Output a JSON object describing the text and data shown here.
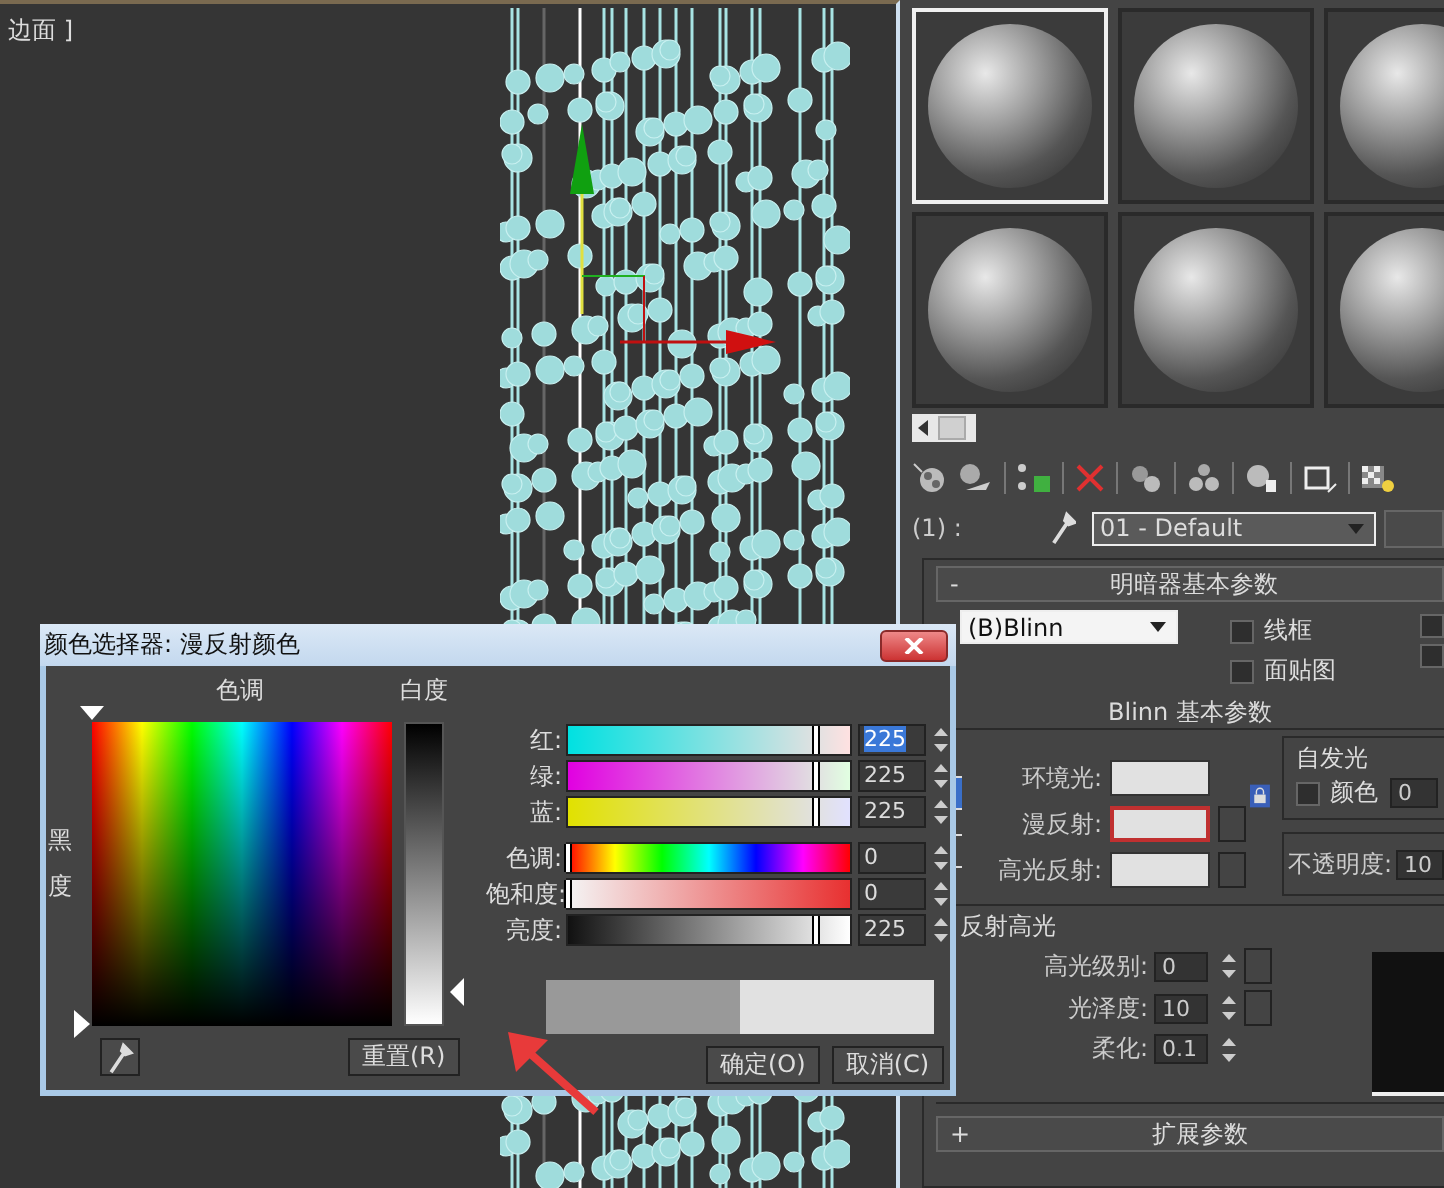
{
  "viewport": {
    "label": "边面 ]"
  },
  "material_editor": {
    "slots": [
      {
        "selected": true
      },
      {
        "selected": false
      },
      {
        "selected": false
      },
      {
        "selected": false
      },
      {
        "selected": false
      },
      {
        "selected": false
      }
    ],
    "material_row": {
      "index": "(1) :",
      "name": "01 - Default"
    },
    "shader_rollout": {
      "sign": "-",
      "title": "明暗器基本参数",
      "shader": "(B)Blinn",
      "checkboxes": [
        {
          "label": "线框",
          "checked": false
        },
        {
          "label": "面贴图",
          "checked": false
        }
      ],
      "extra_checkboxes": [
        {
          "checked": false
        },
        {
          "checked": false
        }
      ]
    },
    "blinn_rollout": {
      "title": "Blinn 基本参数",
      "colors": [
        {
          "label": "环境光:",
          "selected": false,
          "map_button": false
        },
        {
          "label": "漫反射:",
          "selected": true,
          "map_button": true
        },
        {
          "label": "高光反射:",
          "selected": false,
          "map_button": true
        }
      ],
      "self_illum": {
        "title": "自发光",
        "checkbox": {
          "label": "颜色",
          "checked": false
        },
        "value": "0"
      },
      "opacity": {
        "label": "不透明度:",
        "value": "10"
      },
      "specular": {
        "title": "反射高光",
        "fields": [
          {
            "label": "高光级别:",
            "value": "0"
          },
          {
            "label": "光泽度:",
            "value": "10"
          },
          {
            "label": "柔化:",
            "value": "0.1"
          }
        ]
      }
    },
    "collapsed_rollouts": [
      {
        "sign": "+",
        "title": "扩展参数"
      }
    ]
  },
  "color_dialog": {
    "title": "颜色选择器: 漫反射颜色",
    "hue_label": "色调",
    "whiteness_label": "白度",
    "blackness_label": "黑度",
    "sliders": [
      {
        "kind": "red",
        "label": "红:",
        "value": "225",
        "level": 0.88,
        "focused": true
      },
      {
        "kind": "green",
        "label": "绿:",
        "value": "225",
        "level": 0.88,
        "focused": false
      },
      {
        "kind": "blue",
        "label": "蓝:",
        "value": "225",
        "level": 0.88,
        "focused": false
      },
      {
        "kind": "hue",
        "label": "色调:",
        "value": "0",
        "level": 0,
        "focused": false
      },
      {
        "kind": "saturation",
        "label": "饱和度:",
        "value": "0",
        "level": 0,
        "focused": false
      },
      {
        "kind": "value",
        "label": "亮度:",
        "value": "225",
        "level": 0.88,
        "focused": false
      }
    ],
    "buttons": [
      {
        "label": "重置(R)"
      },
      {
        "label": "确定(O)"
      },
      {
        "label": "取消(C)"
      }
    ]
  }
}
